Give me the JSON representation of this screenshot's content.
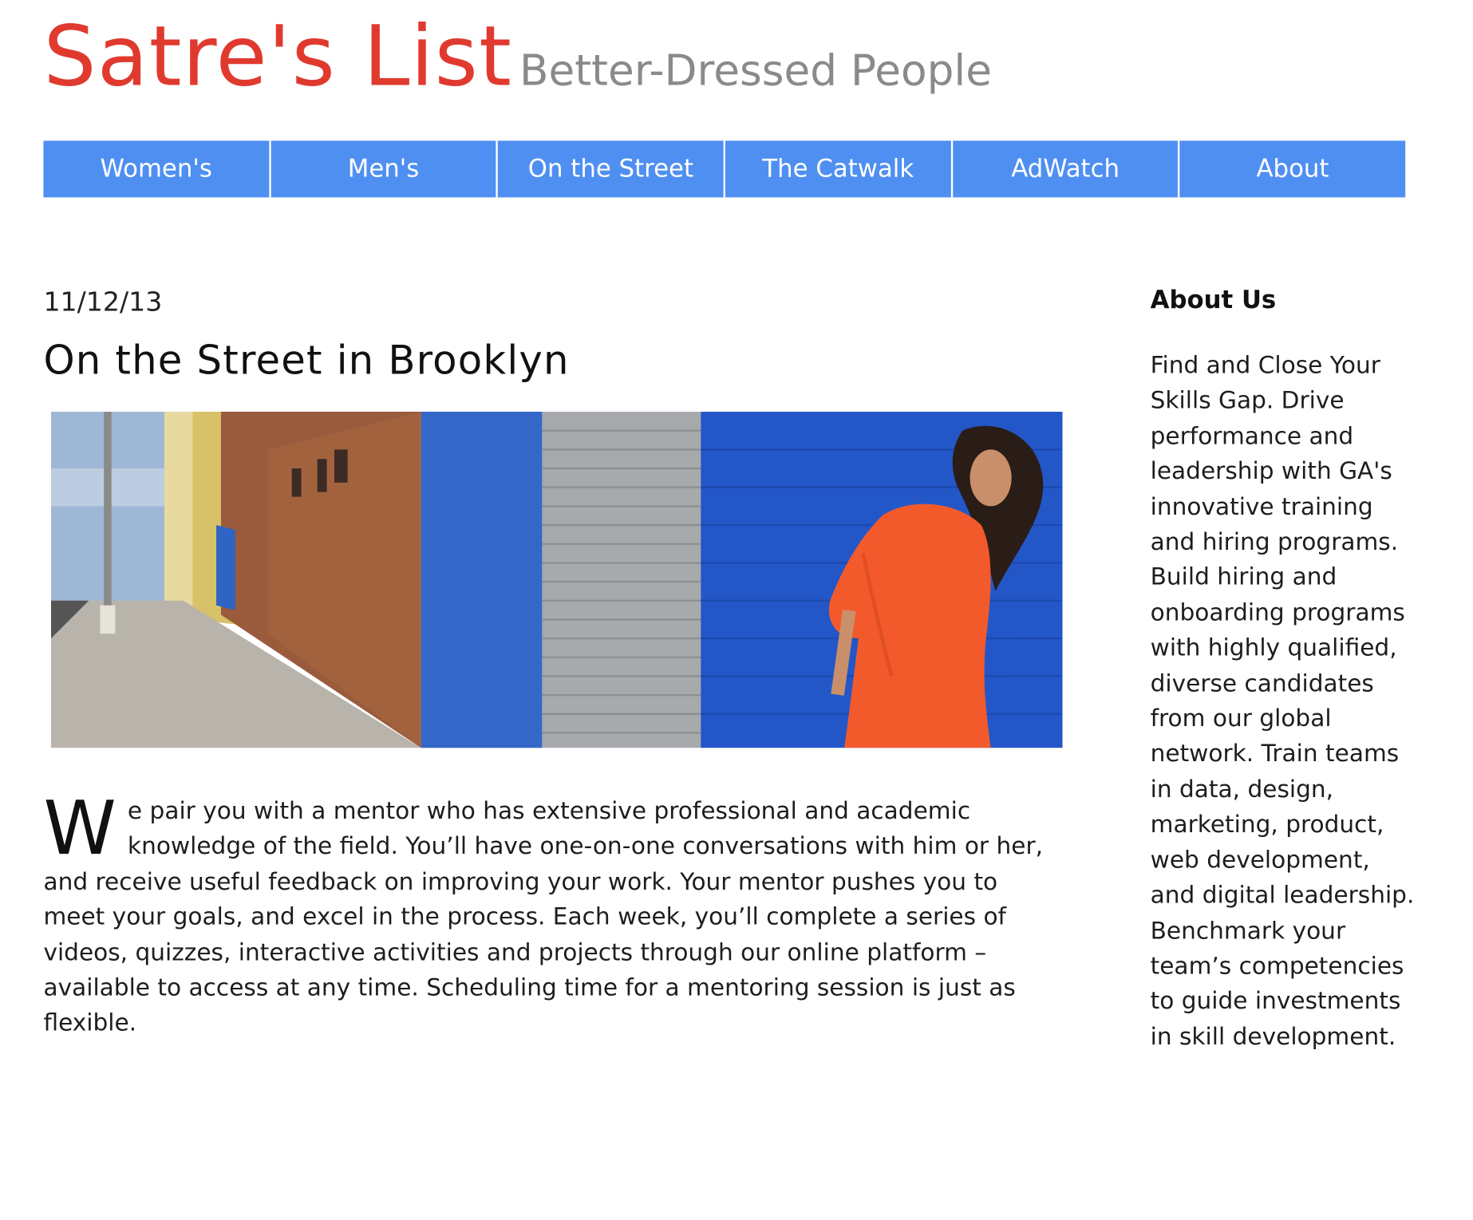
{
  "header": {
    "site_title": "Satre's List",
    "tagline": "Better-Dressed People"
  },
  "nav": {
    "items": [
      {
        "label": "Women's"
      },
      {
        "label": "Men's"
      },
      {
        "label": "On the Street"
      },
      {
        "label": "The Catwalk"
      },
      {
        "label": "AdWatch"
      },
      {
        "label": "About"
      }
    ]
  },
  "article": {
    "date": "11/12/13",
    "title": "On the Street in Brooklyn",
    "drop_cap": "W",
    "body": "e pair you with a mentor who has extensive professional and academic knowledge of the field. You’ll have one-on-one conversations with him or her, and receive useful feedback on improving your work. Your mentor pushes you to meet your goals, and excel in the process. Each week, you’ll complete a series of videos, quizzes, interactive activities and projects through our online platform – available to access at any time. Scheduling time for a mentoring session is just as flexible."
  },
  "sidebar": {
    "title": "About Us",
    "text": "Find and Close Your Skills Gap. Drive performance and leadership with GA's innovative training and hiring programs. Build hiring and onboarding programs with highly qualified, diverse candidates from our global network. Train teams in data, design, marketing, product, web development, and digital leadership. Benchmark your team’s competencies to guide investments in skill development."
  },
  "colors": {
    "brand_red": "#e03a2f",
    "nav_blue": "#4f8ff1",
    "tagline_gray": "#8a8a8a"
  }
}
